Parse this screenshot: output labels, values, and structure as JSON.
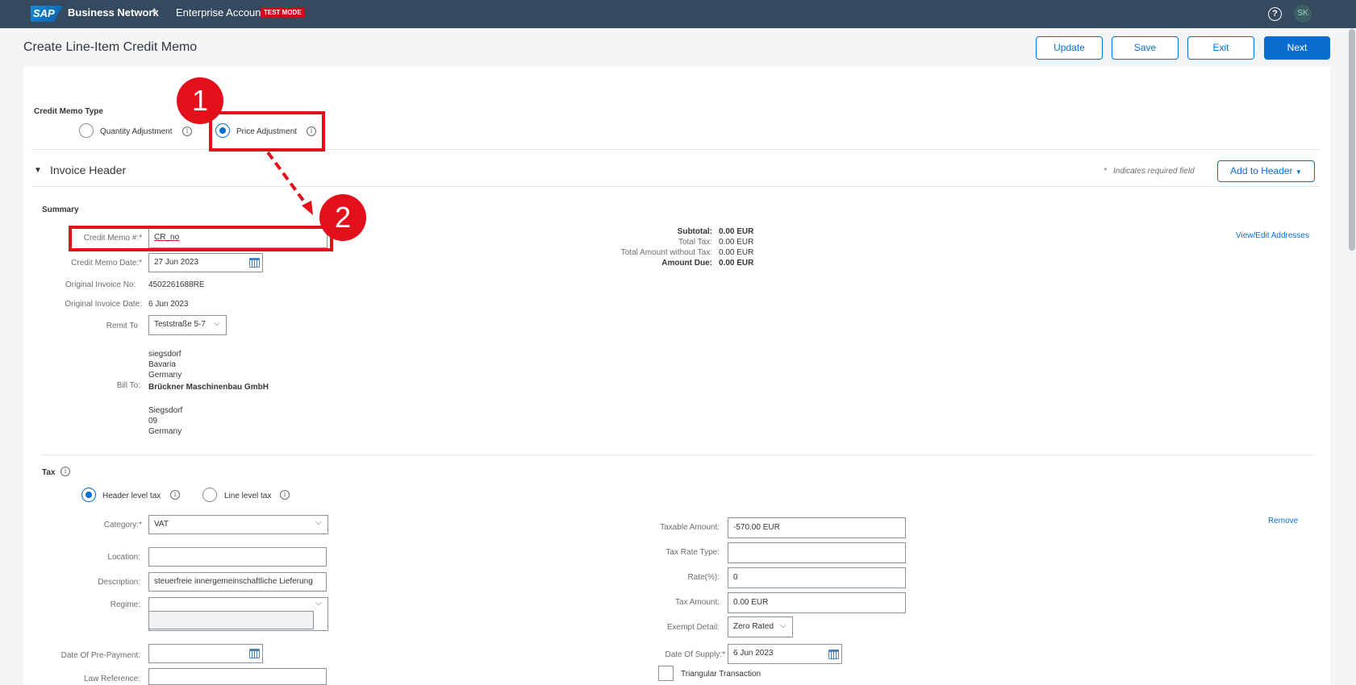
{
  "topbar": {
    "logo": "SAP",
    "app_name": "Business Network",
    "account": "Enterprise Account",
    "test_badge": "TEST MODE",
    "help_icon": "?",
    "avatar_initials": "SK"
  },
  "header": {
    "title": "Create Line-Item Credit Memo",
    "buttons": {
      "update": "Update",
      "save": "Save",
      "exit": "Exit",
      "next": "Next"
    }
  },
  "credit_memo_type": {
    "label": "Credit Memo Type",
    "options": [
      {
        "label": "Quantity Adjustment",
        "selected": false
      },
      {
        "label": "Price Adjustment",
        "selected": true
      }
    ]
  },
  "invoice_header": {
    "title": "Invoice Header",
    "required_note": "Indicates required field",
    "add_to_header": "Add to Header"
  },
  "summary": {
    "title": "Summary",
    "credit_memo_no": {
      "label": "Credit Memo #:",
      "value": "CR_no"
    },
    "credit_memo_date": {
      "label": "Credit Memo Date:",
      "value": "27 Jun 2023"
    },
    "original_invoice_no": {
      "label": "Original Invoice No:",
      "value": "4502261688RE"
    },
    "original_invoice_date": {
      "label": "Original Invoice Date:",
      "value": "6 Jun 2023"
    },
    "remit_to": {
      "label": "Remit To",
      "value": "Teststraße 5-7"
    },
    "remit_address": [
      "siegsdorf",
      "Bavaria",
      "Germany"
    ],
    "bill_to": {
      "label": "Bill To:",
      "name": "Brückner Maschinenbau GmbH",
      "address": [
        "Siegsdorf",
        "09",
        "Germany"
      ]
    },
    "totals": [
      {
        "label": "Subtotal:",
        "value": "0.00 EUR",
        "bold": true
      },
      {
        "label": "Total Tax:",
        "value": "0.00 EUR",
        "bold": false
      },
      {
        "label": "Total Amount without Tax:",
        "value": "0.00 EUR",
        "bold": false
      },
      {
        "label": "Amount Due:",
        "value": "0.00 EUR",
        "bold": true
      }
    ],
    "view_edit_addresses": "View/Edit Addresses"
  },
  "tax": {
    "title": "Tax",
    "options": [
      {
        "label": "Header level tax",
        "selected": true
      },
      {
        "label": "Line level tax",
        "selected": false
      }
    ],
    "category": {
      "label": "Category:",
      "value": "VAT"
    },
    "location": {
      "label": "Location:",
      "value": ""
    },
    "description": {
      "label": "Description:",
      "value": "steuerfreie innergemeinschaftliche Lieferung"
    },
    "regime": {
      "label": "Regime:",
      "value": ""
    },
    "date_of_prepayment": {
      "label": "Date Of Pre-Payment:",
      "value": ""
    },
    "law_reference": {
      "label": "Law Reference:",
      "value": ""
    },
    "taxable_amount": {
      "label": "Taxable Amount:",
      "value": "-570.00 EUR"
    },
    "tax_rate_type": {
      "label": "Tax Rate Type:",
      "value": ""
    },
    "rate": {
      "label": "Rate(%):",
      "value": "0"
    },
    "tax_amount": {
      "label": "Tax Amount:",
      "value": "0.00 EUR"
    },
    "exempt_detail": {
      "label": "Exempt Detail:",
      "value": "Zero Rated"
    },
    "date_of_supply": {
      "label": "Date Of Supply:",
      "value": "6 Jun 2023"
    },
    "triangular": {
      "label": "Triangular Transaction"
    },
    "remove": "Remove"
  },
  "annotations": {
    "step1": "1",
    "step2": "2"
  },
  "colors": {
    "topbar": "#354a5f",
    "accent": "#0a6ed1",
    "annotation": "#e3101c"
  }
}
